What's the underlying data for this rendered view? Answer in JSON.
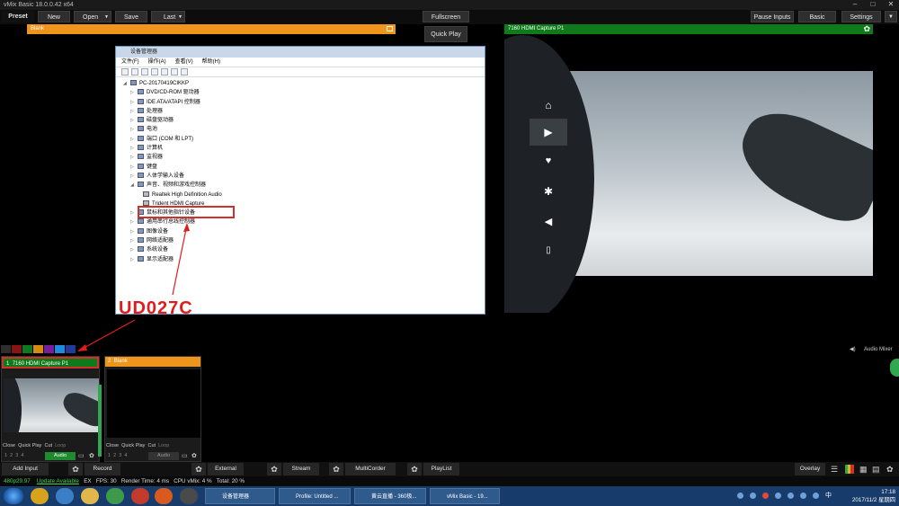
{
  "window": {
    "title": "vMix Basic  18.0.0.42 x64"
  },
  "toolbar": {
    "preset": "Preset",
    "new": "New",
    "open": "Open",
    "save": "Save",
    "last": "Last",
    "fullscreen": "Fullscreen",
    "pause_inputs": "Pause Inputs",
    "basic": "Basic",
    "settings": "Settings"
  },
  "preview": {
    "title": "Blank"
  },
  "quick_play": "Quick Play",
  "output": {
    "title": "7160 HDMI Capture P1"
  },
  "device_manager": {
    "title": "设备管理器",
    "menu": [
      "文件(F)",
      "操作(A)",
      "查看(V)",
      "帮助(H)"
    ],
    "root": "PC-20170419CIKKP",
    "items": [
      "DVD/CD-ROM 驱动器",
      "IDE ATA/ATAPI 控制器",
      "处理器",
      "磁盘驱动器",
      "电池",
      "端口 (COM 和 LPT)",
      "计算机",
      "监视器",
      "键盘",
      "人体学输入设备",
      "声音、视频和游戏控制器",
      "Realtek High Definition Audio",
      "Trident HDMI Capture",
      "鼠标和其他指针设备",
      "通用串行总线控制器",
      "图像设备",
      "网络适配器",
      "系统设备",
      "显示适配器"
    ]
  },
  "annotation": {
    "label": "UD027C"
  },
  "audio_mixer": "Audio Mixer",
  "inputs": [
    {
      "num": "1",
      "title": "7160 HDMI Capture P1",
      "close": "Close",
      "quick_play": "Quick Play",
      "cut": "Cut",
      "loop": "Loop",
      "audio": "Audio",
      "slots": [
        "1",
        "2",
        "3",
        "4"
      ]
    },
    {
      "num": "2",
      "title": "Blank",
      "close": "Close",
      "quick_play": "Quick Play",
      "cut": "Cut",
      "loop": "Loop",
      "audio": "Audio",
      "slots": [
        "1",
        "2",
        "3",
        "4"
      ]
    }
  ],
  "bottom": {
    "add_input": "Add Input",
    "record": "Record",
    "external": "External",
    "stream": "Stream",
    "multicorder": "MultiCorder",
    "playlist": "PlayList",
    "overlay": "Overlay"
  },
  "status": {
    "resolution": "480p29.97",
    "update": "Update Available",
    "ex": "EX",
    "fps": "FPS: 30",
    "render_time": "Render Time: 4 ms",
    "cpu": "CPU vMix: 4 %",
    "total": "Total: 20 %"
  },
  "taskbar": {
    "items": [
      "设备管理器",
      "Profile: Untitled ...",
      "黄云直播 - 360极...",
      "vMix Basic - 19..."
    ],
    "time": "17:18",
    "date": "2017/11/2 星期四",
    "lang": "中"
  },
  "colors": {
    "preview_header": "#f0951c",
    "output_header": "#0f7a1a",
    "input1_header": "#0f7a1a",
    "input2_header": "#f0951c",
    "annotation": "#e01c1c",
    "swatches": [
      "#2e2e2e",
      "#8a1414",
      "#0e7a1e",
      "#d88a10",
      "#7a1ea0",
      "#1e8ae0",
      "#223a9a"
    ]
  }
}
